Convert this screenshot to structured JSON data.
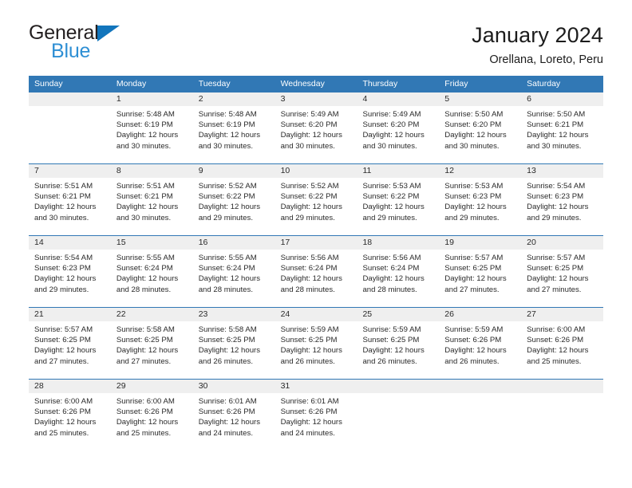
{
  "logo": {
    "word1": "General",
    "word2": "Blue",
    "triangle_color": "#1275bc",
    "blue_text_color": "#2e8fd4"
  },
  "header": {
    "title": "January 2024",
    "subtitle": "Orellana, Loreto, Peru"
  },
  "theme": {
    "header_blue": "#3178b5",
    "number_band": "#efefef",
    "cell_bg": "#ffffff",
    "text": "#2a2a2a"
  },
  "calendar": {
    "weekday_headers": [
      "Sunday",
      "Monday",
      "Tuesday",
      "Wednesday",
      "Thursday",
      "Friday",
      "Saturday"
    ],
    "labels": {
      "sunrise": "Sunrise:",
      "sunset": "Sunset:",
      "daylight": "Daylight:"
    },
    "weeks": [
      [
        {
          "day": "",
          "sunrise": "",
          "sunset": "",
          "daylight_1": "",
          "daylight_2": "",
          "empty": true
        },
        {
          "day": "1",
          "sunrise": "Sunrise: 5:48 AM",
          "sunset": "Sunset: 6:19 PM",
          "daylight_1": "Daylight: 12 hours",
          "daylight_2": "and 30 minutes.",
          "empty": false
        },
        {
          "day": "2",
          "sunrise": "Sunrise: 5:48 AM",
          "sunset": "Sunset: 6:19 PM",
          "daylight_1": "Daylight: 12 hours",
          "daylight_2": "and 30 minutes.",
          "empty": false
        },
        {
          "day": "3",
          "sunrise": "Sunrise: 5:49 AM",
          "sunset": "Sunset: 6:20 PM",
          "daylight_1": "Daylight: 12 hours",
          "daylight_2": "and 30 minutes.",
          "empty": false
        },
        {
          "day": "4",
          "sunrise": "Sunrise: 5:49 AM",
          "sunset": "Sunset: 6:20 PM",
          "daylight_1": "Daylight: 12 hours",
          "daylight_2": "and 30 minutes.",
          "empty": false
        },
        {
          "day": "5",
          "sunrise": "Sunrise: 5:50 AM",
          "sunset": "Sunset: 6:20 PM",
          "daylight_1": "Daylight: 12 hours",
          "daylight_2": "and 30 minutes.",
          "empty": false
        },
        {
          "day": "6",
          "sunrise": "Sunrise: 5:50 AM",
          "sunset": "Sunset: 6:21 PM",
          "daylight_1": "Daylight: 12 hours",
          "daylight_2": "and 30 minutes.",
          "empty": false
        }
      ],
      [
        {
          "day": "7",
          "sunrise": "Sunrise: 5:51 AM",
          "sunset": "Sunset: 6:21 PM",
          "daylight_1": "Daylight: 12 hours",
          "daylight_2": "and 30 minutes.",
          "empty": false
        },
        {
          "day": "8",
          "sunrise": "Sunrise: 5:51 AM",
          "sunset": "Sunset: 6:21 PM",
          "daylight_1": "Daylight: 12 hours",
          "daylight_2": "and 30 minutes.",
          "empty": false
        },
        {
          "day": "9",
          "sunrise": "Sunrise: 5:52 AM",
          "sunset": "Sunset: 6:22 PM",
          "daylight_1": "Daylight: 12 hours",
          "daylight_2": "and 29 minutes.",
          "empty": false
        },
        {
          "day": "10",
          "sunrise": "Sunrise: 5:52 AM",
          "sunset": "Sunset: 6:22 PM",
          "daylight_1": "Daylight: 12 hours",
          "daylight_2": "and 29 minutes.",
          "empty": false
        },
        {
          "day": "11",
          "sunrise": "Sunrise: 5:53 AM",
          "sunset": "Sunset: 6:22 PM",
          "daylight_1": "Daylight: 12 hours",
          "daylight_2": "and 29 minutes.",
          "empty": false
        },
        {
          "day": "12",
          "sunrise": "Sunrise: 5:53 AM",
          "sunset": "Sunset: 6:23 PM",
          "daylight_1": "Daylight: 12 hours",
          "daylight_2": "and 29 minutes.",
          "empty": false
        },
        {
          "day": "13",
          "sunrise": "Sunrise: 5:54 AM",
          "sunset": "Sunset: 6:23 PM",
          "daylight_1": "Daylight: 12 hours",
          "daylight_2": "and 29 minutes.",
          "empty": false
        }
      ],
      [
        {
          "day": "14",
          "sunrise": "Sunrise: 5:54 AM",
          "sunset": "Sunset: 6:23 PM",
          "daylight_1": "Daylight: 12 hours",
          "daylight_2": "and 29 minutes.",
          "empty": false
        },
        {
          "day": "15",
          "sunrise": "Sunrise: 5:55 AM",
          "sunset": "Sunset: 6:24 PM",
          "daylight_1": "Daylight: 12 hours",
          "daylight_2": "and 28 minutes.",
          "empty": false
        },
        {
          "day": "16",
          "sunrise": "Sunrise: 5:55 AM",
          "sunset": "Sunset: 6:24 PM",
          "daylight_1": "Daylight: 12 hours",
          "daylight_2": "and 28 minutes.",
          "empty": false
        },
        {
          "day": "17",
          "sunrise": "Sunrise: 5:56 AM",
          "sunset": "Sunset: 6:24 PM",
          "daylight_1": "Daylight: 12 hours",
          "daylight_2": "and 28 minutes.",
          "empty": false
        },
        {
          "day": "18",
          "sunrise": "Sunrise: 5:56 AM",
          "sunset": "Sunset: 6:24 PM",
          "daylight_1": "Daylight: 12 hours",
          "daylight_2": "and 28 minutes.",
          "empty": false
        },
        {
          "day": "19",
          "sunrise": "Sunrise: 5:57 AM",
          "sunset": "Sunset: 6:25 PM",
          "daylight_1": "Daylight: 12 hours",
          "daylight_2": "and 27 minutes.",
          "empty": false
        },
        {
          "day": "20",
          "sunrise": "Sunrise: 5:57 AM",
          "sunset": "Sunset: 6:25 PM",
          "daylight_1": "Daylight: 12 hours",
          "daylight_2": "and 27 minutes.",
          "empty": false
        }
      ],
      [
        {
          "day": "21",
          "sunrise": "Sunrise: 5:57 AM",
          "sunset": "Sunset: 6:25 PM",
          "daylight_1": "Daylight: 12 hours",
          "daylight_2": "and 27 minutes.",
          "empty": false
        },
        {
          "day": "22",
          "sunrise": "Sunrise: 5:58 AM",
          "sunset": "Sunset: 6:25 PM",
          "daylight_1": "Daylight: 12 hours",
          "daylight_2": "and 27 minutes.",
          "empty": false
        },
        {
          "day": "23",
          "sunrise": "Sunrise: 5:58 AM",
          "sunset": "Sunset: 6:25 PM",
          "daylight_1": "Daylight: 12 hours",
          "daylight_2": "and 26 minutes.",
          "empty": false
        },
        {
          "day": "24",
          "sunrise": "Sunrise: 5:59 AM",
          "sunset": "Sunset: 6:25 PM",
          "daylight_1": "Daylight: 12 hours",
          "daylight_2": "and 26 minutes.",
          "empty": false
        },
        {
          "day": "25",
          "sunrise": "Sunrise: 5:59 AM",
          "sunset": "Sunset: 6:25 PM",
          "daylight_1": "Daylight: 12 hours",
          "daylight_2": "and 26 minutes.",
          "empty": false
        },
        {
          "day": "26",
          "sunrise": "Sunrise: 5:59 AM",
          "sunset": "Sunset: 6:26 PM",
          "daylight_1": "Daylight: 12 hours",
          "daylight_2": "and 26 minutes.",
          "empty": false
        },
        {
          "day": "27",
          "sunrise": "Sunrise: 6:00 AM",
          "sunset": "Sunset: 6:26 PM",
          "daylight_1": "Daylight: 12 hours",
          "daylight_2": "and 25 minutes.",
          "empty": false
        }
      ],
      [
        {
          "day": "28",
          "sunrise": "Sunrise: 6:00 AM",
          "sunset": "Sunset: 6:26 PM",
          "daylight_1": "Daylight: 12 hours",
          "daylight_2": "and 25 minutes.",
          "empty": false
        },
        {
          "day": "29",
          "sunrise": "Sunrise: 6:00 AM",
          "sunset": "Sunset: 6:26 PM",
          "daylight_1": "Daylight: 12 hours",
          "daylight_2": "and 25 minutes.",
          "empty": false
        },
        {
          "day": "30",
          "sunrise": "Sunrise: 6:01 AM",
          "sunset": "Sunset: 6:26 PM",
          "daylight_1": "Daylight: 12 hours",
          "daylight_2": "and 24 minutes.",
          "empty": false
        },
        {
          "day": "31",
          "sunrise": "Sunrise: 6:01 AM",
          "sunset": "Sunset: 6:26 PM",
          "daylight_1": "Daylight: 12 hours",
          "daylight_2": "and 24 minutes.",
          "empty": false
        },
        {
          "day": "",
          "sunrise": "",
          "sunset": "",
          "daylight_1": "",
          "daylight_2": "",
          "empty": true
        },
        {
          "day": "",
          "sunrise": "",
          "sunset": "",
          "daylight_1": "",
          "daylight_2": "",
          "empty": true
        },
        {
          "day": "",
          "sunrise": "",
          "sunset": "",
          "daylight_1": "",
          "daylight_2": "",
          "empty": true
        }
      ]
    ]
  }
}
